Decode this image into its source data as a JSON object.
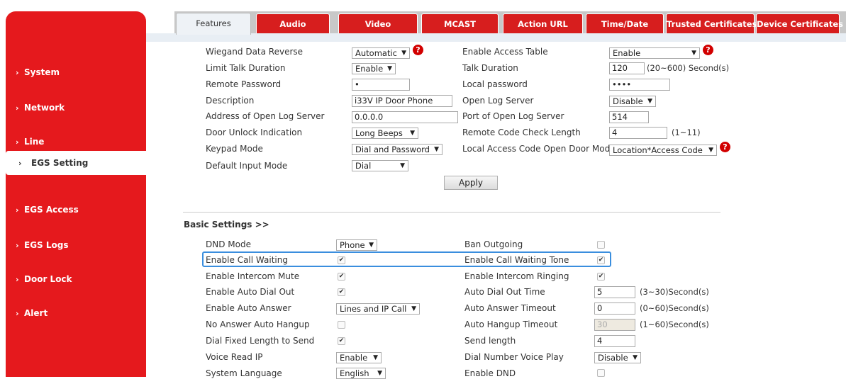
{
  "sidebar": {
    "items": [
      {
        "label": "System"
      },
      {
        "label": "Network"
      },
      {
        "label": "Line"
      },
      {
        "label": "EGS Setting"
      },
      {
        "label": "EGS Access"
      },
      {
        "label": "EGS Logs"
      },
      {
        "label": "Door Lock"
      },
      {
        "label": "Alert"
      }
    ],
    "arrow": "›",
    "active_index": 3
  },
  "tabs": [
    {
      "label": "Features"
    },
    {
      "label": "Audio"
    },
    {
      "label": "Video"
    },
    {
      "label": "MCAST"
    },
    {
      "label": "Action URL"
    },
    {
      "label": "Time/Date"
    },
    {
      "label": "Trusted Certificates"
    },
    {
      "label": "Device Certificates"
    }
  ],
  "egs": {
    "wiegand_data_reverse": {
      "label": "Wiegand Data Reverse",
      "value": "Automatic"
    },
    "enable_access_table": {
      "label": "Enable Access Table",
      "value": "Enable"
    },
    "limit_talk_duration": {
      "label": "Limit Talk Duration",
      "value": "Enable"
    },
    "talk_duration": {
      "label": "Talk Duration",
      "value": "120",
      "note": "(20~600) Second(s)"
    },
    "remote_password": {
      "label": "Remote Password",
      "value": "•"
    },
    "local_password": {
      "label": "Local password",
      "value": "••••"
    },
    "description": {
      "label": "Description",
      "value": "i33V IP Door Phone"
    },
    "open_log_server": {
      "label": "Open Log Server",
      "value": "Disable"
    },
    "address_open_log_server": {
      "label": "Address of Open Log Server",
      "value": "0.0.0.0"
    },
    "port_open_log_server": {
      "label": "Port of Open Log Server",
      "value": "514"
    },
    "door_unlock_indication": {
      "label": "Door Unlock Indication",
      "value": "Long Beeps"
    },
    "remote_code_check_length": {
      "label": "Remote Code Check Length",
      "value": "4",
      "note": "(1~11)"
    },
    "keypad_mode": {
      "label": "Keypad Mode",
      "value": "Dial and Password"
    },
    "local_access_code_open_door_mode": {
      "label": "Local Access Code Open Door Mode",
      "value": "Location*Access Code"
    },
    "default_input_mode": {
      "label": "Default Input Mode",
      "value": "Dial"
    },
    "apply_label": "Apply",
    "warn_glyph": "?"
  },
  "basic": {
    "title": "Basic Settings >>",
    "dnd_mode": {
      "label": "DND Mode",
      "value": "Phone"
    },
    "ban_outgoing": {
      "label": "Ban Outgoing",
      "checked": false
    },
    "enable_call_waiting": {
      "label": "Enable Call Waiting",
      "checked": true
    },
    "enable_call_waiting_tone": {
      "label": "Enable Call Waiting Tone",
      "checked": true
    },
    "enable_intercom_mute": {
      "label": "Enable Intercom Mute",
      "checked": true
    },
    "enable_intercom_ringing": {
      "label": "Enable Intercom Ringing",
      "checked": true
    },
    "enable_auto_dial_out": {
      "label": "Enable Auto Dial Out",
      "checked": true
    },
    "auto_dial_out_time": {
      "label": "Auto Dial Out Time",
      "value": "5",
      "note": "(3~30)Second(s)"
    },
    "enable_auto_answer": {
      "label": "Enable Auto Answer",
      "value": "Lines and IP Call"
    },
    "auto_answer_timeout": {
      "label": "Auto Answer Timeout",
      "value": "0",
      "note": "(0~60)Second(s)"
    },
    "no_answer_auto_hangup": {
      "label": "No Answer Auto Hangup",
      "checked": false
    },
    "auto_hangup_timeout": {
      "label": "Auto Hangup Timeout",
      "value": "30",
      "note": "(1~60)Second(s)"
    },
    "dial_fixed_length_to_send": {
      "label": "Dial Fixed Length to Send",
      "checked": true
    },
    "send_length": {
      "label": "Send length",
      "value": "4"
    },
    "voice_read_ip": {
      "label": "Voice Read IP",
      "value": "Enable"
    },
    "dial_number_voice_play": {
      "label": "Dial Number Voice Play",
      "value": "Disable"
    },
    "system_language": {
      "label": "System Language",
      "value": "English"
    },
    "enable_dnd": {
      "label": "Enable DND",
      "checked": false
    }
  },
  "check_glyph": "✔",
  "select_arrow": "▼",
  "colors": {
    "brand_red": "#e5191d",
    "tab_red": "#d71e1e",
    "highlight_blue": "#3a8ede"
  }
}
